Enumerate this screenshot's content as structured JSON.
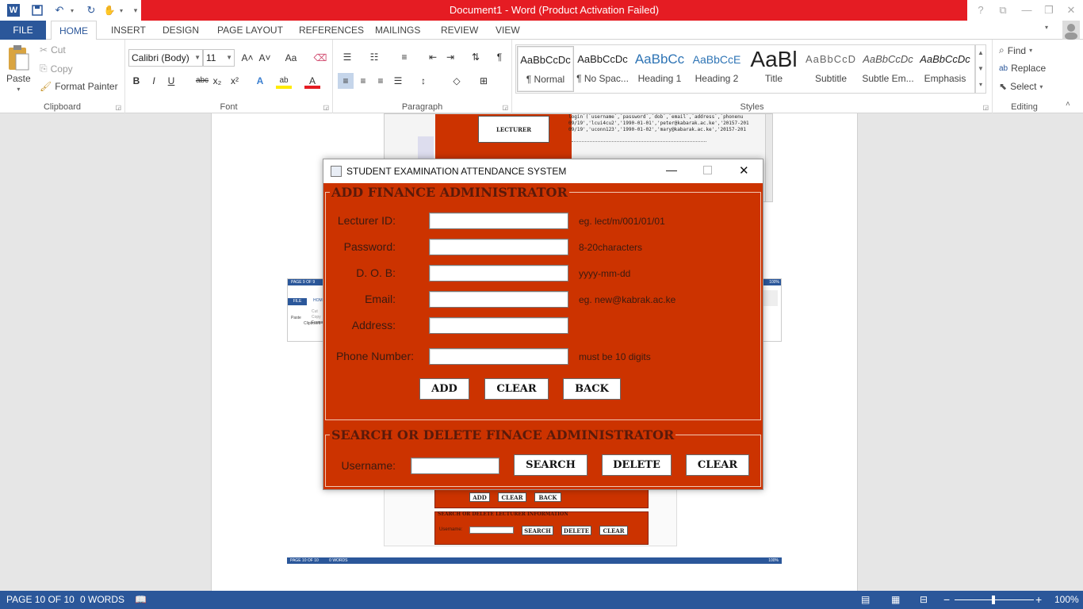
{
  "titlebar": {
    "title": "Document1 -  Word (Product Activation Failed)",
    "help": "?",
    "restore_ribbon": "⧉",
    "minimize": "—",
    "maximize": "❐",
    "close": "✕"
  },
  "quick_access": {
    "app_icon": "W",
    "save_icon": "💾",
    "undo_icon": "↶",
    "redo_icon": "↻",
    "touch_icon": "✋",
    "customize_icon": "▾"
  },
  "tabs": [
    "FILE",
    "HOME",
    "INSERT",
    "DESIGN",
    "PAGE LAYOUT",
    "REFERENCES",
    "MAILINGS",
    "REVIEW",
    "VIEW"
  ],
  "clipboard": {
    "label": "Clipboard",
    "paste": "Paste",
    "cut": "Cut",
    "copy": "Copy",
    "format_painter": "Format Painter"
  },
  "font": {
    "label": "Font",
    "family": "Calibri (Body)",
    "size": "11",
    "grow": "A˄",
    "shrink": "A˅",
    "case": "Aa",
    "clear": "⌫",
    "bold": "B",
    "italic": "I",
    "underline": "U",
    "strike": "abc",
    "subscript": "x₂",
    "superscript": "x²",
    "effects": "A",
    "highlight": "ab",
    "color": "A"
  },
  "paragraph": {
    "label": "Paragraph"
  },
  "styles": {
    "label": "Styles",
    "items": [
      {
        "preview": "AaBbCcDc",
        "name": "¶ Normal"
      },
      {
        "preview": "AaBbCcDc",
        "name": "¶ No Spac..."
      },
      {
        "preview": "AaBbCc",
        "name": "Heading 1"
      },
      {
        "preview": "AaBbCcE",
        "name": "Heading 2"
      },
      {
        "preview": "AaBl",
        "name": "Title"
      },
      {
        "preview": "AaBbCcD",
        "name": "Subtitle"
      },
      {
        "preview": "AaBbCcDc",
        "name": "Subtle Em..."
      },
      {
        "preview": "AaBbCcDc",
        "name": "Emphasis"
      }
    ]
  },
  "editing": {
    "label": "Editing",
    "find": "Find",
    "replace": "Replace",
    "select": "Select"
  },
  "background_images": {
    "top_button": "LECTURER",
    "code_lines": [
      "login`(`username`,`password`,`dob`,`email`,`address`,`phonenu",
      "09/19','lcui4cu2','1990-01-01','peter@kabarak.ac.ke','20157-201",
      "09/19','uconn123','1990-01-02','mary@kabarak.ac.ke','20157-201"
    ],
    "mini_page_label": "PAGE 9 OF 9",
    "mini_zoom": "100%",
    "mini_file": "FILE",
    "mini_home": "HOM",
    "mini_paste": "Paste",
    "mini_cut": "Cut",
    "mini_copy": "Copy",
    "mini_format": "Forma",
    "mini_clipboard": "Clipboard",
    "bottom_buttons": [
      "ADD",
      "CLEAR",
      "BACK"
    ],
    "bottom_title": "SEARCH OR DELETE LECTURER INFORMATION",
    "bottom_username": "Username:",
    "bottom_actions": [
      "SEARCH",
      "DELETE",
      "CLEAR"
    ],
    "bottom_status_page": "PAGE 10 OF 10",
    "bottom_status_words": "0 WORDS",
    "bottom_status_zoom": "100%"
  },
  "dialog": {
    "title": "STUDENT EXAMINATION ATTENDANCE SYSTEM",
    "add_panel_title": "ADD FINANCE ADMINISTRATOR",
    "fields": [
      {
        "label": "Lecturer ID:",
        "value": "",
        "hint": "eg. lect/m/001/01/01"
      },
      {
        "label": "Password:",
        "value": "",
        "hint": "8-20characters"
      },
      {
        "label": "D. O. B:",
        "value": "",
        "hint": "yyyy-mm-dd"
      },
      {
        "label": "Email:",
        "value": "",
        "hint": "eg. new@kabrak.ac.ke"
      },
      {
        "label": "Address:",
        "value": "",
        "hint": ""
      },
      {
        "label": "Phone Number:",
        "value": "",
        "hint": "must be 10 digits"
      }
    ],
    "add_button": "ADD",
    "clear_button": "CLEAR",
    "back_button": "BACK",
    "search_panel_title": "SEARCH OR DELETE FINACE ADMINISTRATOR",
    "username_label": "Username:",
    "username_value": "",
    "search_button": "SEARCH",
    "delete_button": "DELETE",
    "clear2_button": "CLEAR"
  },
  "statusbar": {
    "page": "PAGE 10 OF 10",
    "words": "0 WORDS",
    "zoom": "100%",
    "zoom_minus": "−",
    "zoom_plus": "+"
  },
  "colors": {
    "word_blue": "#2b579a",
    "title_red": "#e51c23",
    "form_red": "#cc3300"
  }
}
